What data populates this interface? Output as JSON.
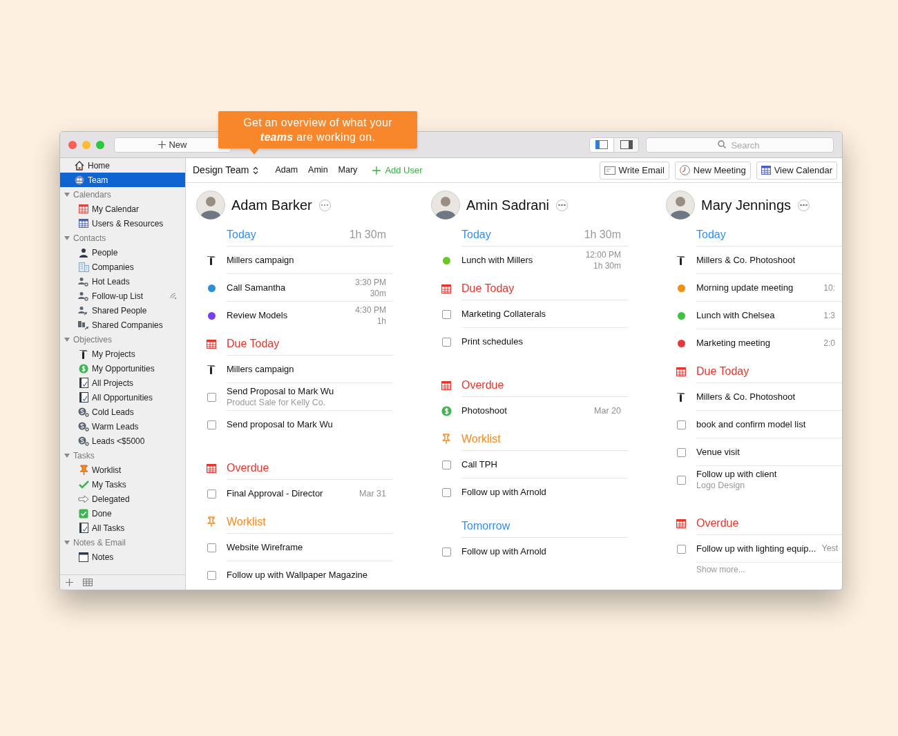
{
  "callout": "Get an overview of what your **teams** are working on.",
  "toolbar": {
    "new_button": "New",
    "views": [
      {
        "kind": "sidebar",
        "on": true
      },
      {
        "kind": "inspector",
        "on": false
      }
    ],
    "search": {
      "placeholder": "Search"
    }
  },
  "sidebar": {
    "items": [
      {
        "kind": "home",
        "label": "Home",
        "selected": false,
        "shared": false
      },
      {
        "kind": "team",
        "label": "Team",
        "selected": true,
        "shared": false
      }
    ],
    "groups": [
      {
        "label": "Calendars",
        "expanded": true,
        "children": [
          {
            "kind": "calendar",
            "label": "My Calendar",
            "selected": false,
            "shared": false
          },
          {
            "kind": "resources",
            "label": "Users & Resources",
            "selected": false,
            "shared": false
          }
        ]
      },
      {
        "label": "Contacts",
        "expanded": true,
        "children": [
          {
            "kind": "person",
            "label": "People",
            "selected": false,
            "shared": false
          },
          {
            "kind": "building",
            "label": "Companies",
            "selected": false,
            "shared": false
          },
          {
            "kind": "smart",
            "label": "Hot Leads",
            "selected": false,
            "shared": false
          },
          {
            "kind": "smart",
            "label": "Follow-up List",
            "selected": false,
            "shared": true
          },
          {
            "kind": "sharedperson",
            "label": "Shared People",
            "selected": false,
            "shared": false
          },
          {
            "kind": "sharedbuilding",
            "label": "Shared Companies",
            "selected": false,
            "shared": false
          }
        ]
      },
      {
        "label": "Objectives",
        "expanded": true,
        "children": [
          {
            "kind": "project",
            "label": "My Projects",
            "selected": false,
            "shared": false
          },
          {
            "kind": "opportunity",
            "label": "My Opportunities",
            "selected": false,
            "shared": false
          },
          {
            "kind": "notebook",
            "label": "All Projects",
            "selected": false,
            "shared": false
          },
          {
            "kind": "notebook",
            "label": "All Opportunities",
            "selected": false,
            "shared": false
          },
          {
            "kind": "lead",
            "label": "Cold Leads",
            "selected": false,
            "shared": false
          },
          {
            "kind": "lead",
            "label": "Warm Leads",
            "selected": false,
            "shared": false
          },
          {
            "kind": "lead",
            "label": "Leads <$5000",
            "selected": false,
            "shared": false
          }
        ]
      },
      {
        "label": "Tasks",
        "expanded": true,
        "children": [
          {
            "kind": "worklist",
            "label": "Worklist",
            "selected": false,
            "shared": false
          },
          {
            "kind": "check",
            "label": "My Tasks",
            "selected": false,
            "shared": false
          },
          {
            "kind": "delegate",
            "label": "Delegated",
            "selected": false,
            "shared": false
          },
          {
            "kind": "done",
            "label": "Done",
            "selected": false,
            "shared": false
          },
          {
            "kind": "notebook",
            "label": "All Tasks",
            "selected": false,
            "shared": false
          }
        ]
      },
      {
        "label": "Notes & Email",
        "expanded": true,
        "children": [
          {
            "kind": "notes",
            "label": "Notes",
            "selected": false,
            "shared": false
          }
        ]
      }
    ]
  },
  "team_bar": {
    "team": "Design Team",
    "members": [
      "Adam",
      "Amin",
      "Mary"
    ],
    "add_user": "Add User",
    "actions": [
      {
        "kind": "email",
        "label": "Write Email"
      },
      {
        "kind": "meeting",
        "label": "New Meeting"
      },
      {
        "kind": "calendar",
        "label": "View Calendar"
      }
    ]
  },
  "columns": [
    {
      "name": "Adam Barker",
      "sections": [
        {
          "kind": "today",
          "title": "Today",
          "total": "1h 30m",
          "items": [
            {
              "kind": "project",
              "title": "Millers campaign"
            },
            {
              "kind": "event",
              "title": "Call Samantha",
              "time": "3:30 PM",
              "duration": "30m",
              "color": "#2b8fd8"
            },
            {
              "kind": "event",
              "title": "Review Models",
              "time": "4:30 PM",
              "duration": "1h",
              "color": "#7a3ff0"
            }
          ]
        },
        {
          "kind": "due",
          "title": "Due Today",
          "items": [
            {
              "kind": "project",
              "title": "Millers campaign"
            },
            {
              "kind": "task",
              "title": "Send Proposal to Mark Wu",
              "subtitle": "Product Sale for Kelly Co.",
              "checked": false
            },
            {
              "kind": "task",
              "title": "Send proposal to Mark Wu",
              "checked": false
            }
          ]
        },
        {
          "kind": "overdue",
          "title": "Overdue",
          "items": [
            {
              "kind": "task",
              "title": "Final Approval - Director",
              "date": "Mar 31",
              "checked": false
            }
          ]
        },
        {
          "kind": "worklist",
          "title": "Worklist",
          "items": [
            {
              "kind": "task",
              "title": "Website Wireframe",
              "checked": false
            },
            {
              "kind": "task",
              "title": "Follow up with Wallpaper Magazine",
              "checked": false
            }
          ]
        }
      ]
    },
    {
      "name": "Amin Sadrani",
      "sections": [
        {
          "kind": "today",
          "title": "Today",
          "total": "1h 30m",
          "items": [
            {
              "kind": "event",
              "title": "Lunch with Millers",
              "time": "12:00 PM",
              "duration": "1h 30m",
              "color": "#6cc623"
            }
          ]
        },
        {
          "kind": "due",
          "title": "Due Today",
          "items": [
            {
              "kind": "task",
              "title": "Marketing Collaterals",
              "checked": false
            },
            {
              "kind": "task",
              "title": "Print schedules",
              "checked": false
            }
          ]
        },
        {
          "kind": "overdue",
          "title": "Overdue",
          "items": [
            {
              "kind": "opportunity",
              "title": "Photoshoot",
              "date": "Mar 20"
            }
          ]
        },
        {
          "kind": "worklist",
          "title": "Worklist",
          "items": [
            {
              "kind": "task",
              "title": "Call TPH",
              "checked": false
            },
            {
              "kind": "task",
              "title": "Follow up with Arnold",
              "checked": false
            }
          ]
        },
        {
          "kind": "tomorrow",
          "title": "Tomorrow",
          "items": [
            {
              "kind": "task",
              "title": "Follow up with Arnold",
              "checked": false
            }
          ]
        }
      ]
    },
    {
      "name": "Mary Jennings",
      "sections": [
        {
          "kind": "today",
          "title": "Today",
          "items": [
            {
              "kind": "project",
              "title": "Millers & Co. Photoshoot"
            },
            {
              "kind": "event",
              "title": "Morning update meeting",
              "time": "10:",
              "color": "#f39014"
            },
            {
              "kind": "event",
              "title": "Lunch with Chelsea",
              "time": "1:3",
              "color": "#3cc23c"
            },
            {
              "kind": "event",
              "title": "Marketing meeting",
              "time": "2:0",
              "color": "#e8383c"
            }
          ]
        },
        {
          "kind": "due",
          "title": "Due Today",
          "items": [
            {
              "kind": "project",
              "title": "Millers & Co. Photoshoot"
            },
            {
              "kind": "task",
              "title": "book and confirm model list",
              "checked": false
            },
            {
              "kind": "task",
              "title": "Venue visit",
              "checked": false
            },
            {
              "kind": "task",
              "title": "Follow up with client",
              "subtitle": "Logo Design",
              "checked": false
            }
          ]
        },
        {
          "kind": "overdue",
          "title": "Overdue",
          "items": [
            {
              "kind": "task",
              "title": "Follow up with lighting equip...",
              "date": "Yest",
              "checked": false
            }
          ],
          "more": "Show more..."
        }
      ]
    }
  ]
}
